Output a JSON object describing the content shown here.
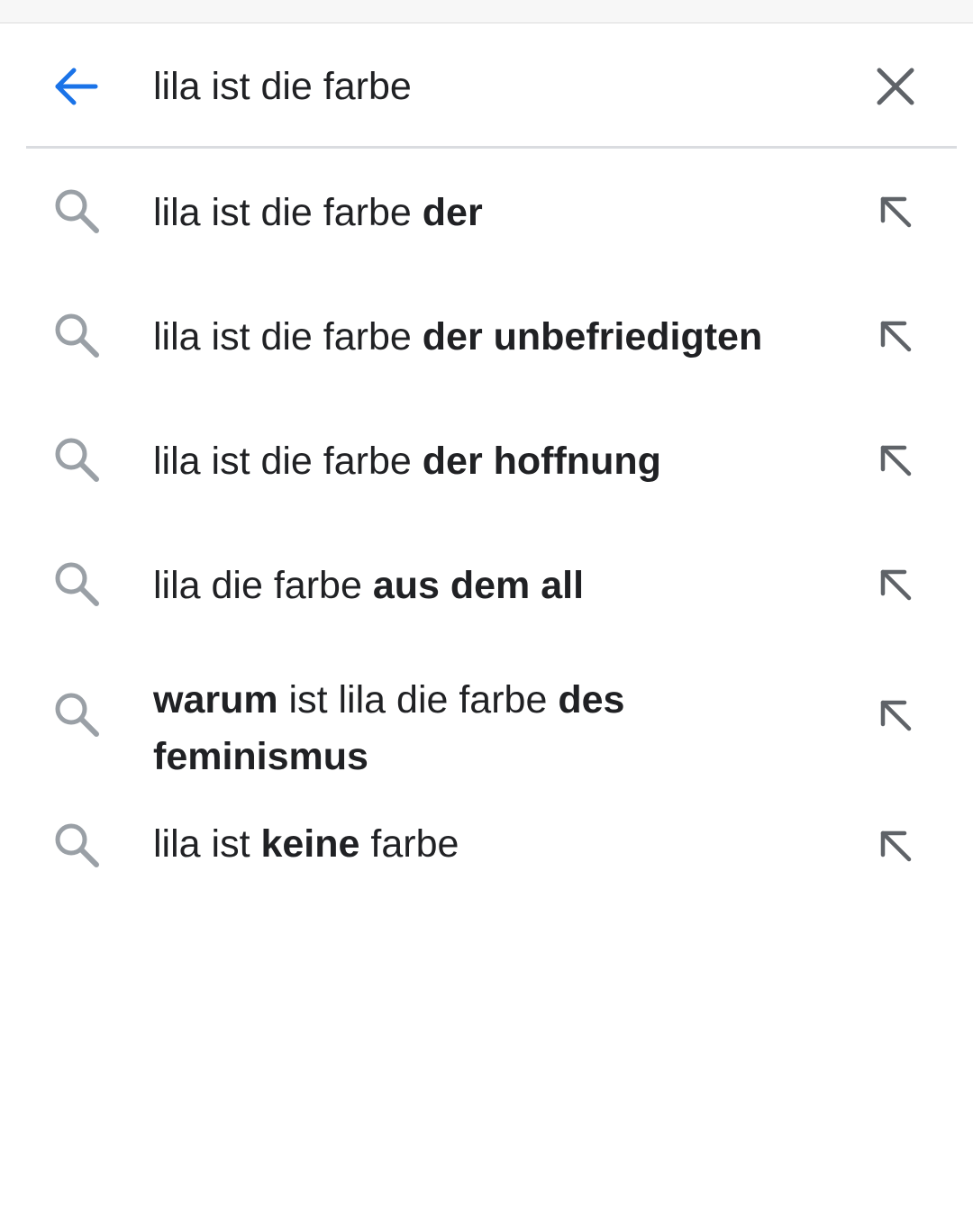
{
  "search": {
    "query": "lila ist die farbe",
    "back_icon": "arrow-left-icon",
    "clear_icon": "close-icon",
    "accent_color": "#1a73e8"
  },
  "suggestions": [
    {
      "parts": [
        {
          "text": "lila ist die farbe ",
          "bold": false
        },
        {
          "text": "der",
          "bold": true
        }
      ]
    },
    {
      "parts": [
        {
          "text": "lila ist die farbe ",
          "bold": false
        },
        {
          "text": "der unbefriedigten",
          "bold": true
        }
      ]
    },
    {
      "parts": [
        {
          "text": "lila ist die farbe ",
          "bold": false
        },
        {
          "text": "der hoffnung",
          "bold": true
        }
      ]
    },
    {
      "parts": [
        {
          "text": "lila die farbe ",
          "bold": false
        },
        {
          "text": "aus dem all",
          "bold": true
        }
      ]
    },
    {
      "parts": [
        {
          "text": "warum",
          "bold": true
        },
        {
          "text": " ist lila die farbe ",
          "bold": false
        },
        {
          "text": "des feminismus",
          "bold": true
        }
      ]
    },
    {
      "parts": [
        {
          "text": "lila ist ",
          "bold": false
        },
        {
          "text": "keine",
          "bold": true
        },
        {
          "text": " farbe",
          "bold": false
        }
      ]
    }
  ],
  "icons": {
    "suggestion_icon": "search-icon",
    "fill_icon": "arrow-up-left-icon"
  }
}
